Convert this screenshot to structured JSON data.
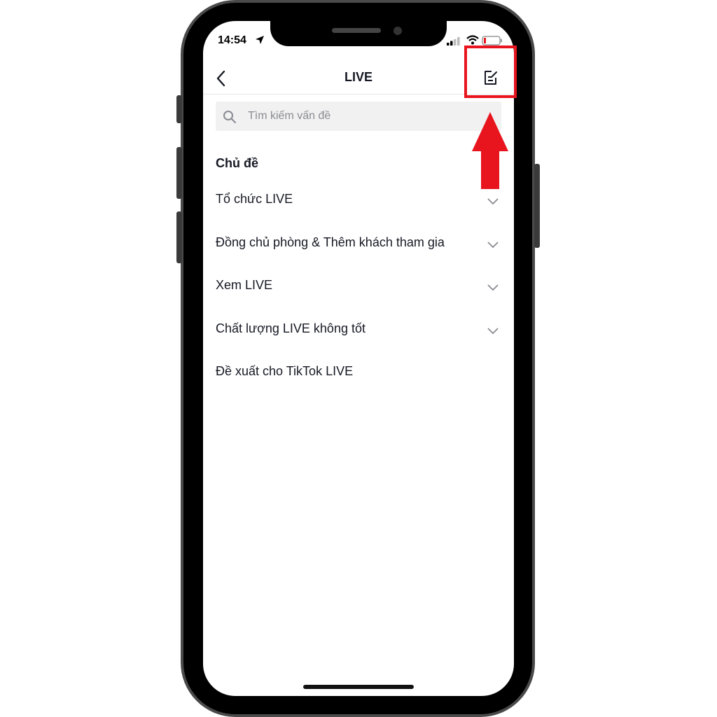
{
  "status_bar": {
    "time": "14:54"
  },
  "header": {
    "title": "LIVE"
  },
  "search": {
    "placeholder": "Tìm kiếm vấn đề"
  },
  "section": {
    "title": "Chủ đề"
  },
  "topics": [
    {
      "label": "Tổ chức LIVE",
      "expandable": true
    },
    {
      "label": "Đồng chủ phòng & Thêm khách tham gia",
      "expandable": true
    },
    {
      "label": "Xem LIVE",
      "expandable": true
    },
    {
      "label": "Chất lượng LIVE không tốt",
      "expandable": true
    },
    {
      "label": "Đề xuất cho TikTok LIVE",
      "expandable": false
    }
  ],
  "icons": {
    "back": "chevron-left-icon",
    "edit": "edit-note-icon",
    "search": "search-icon",
    "expand": "chevron-down-icon"
  },
  "colors": {
    "annotation": "#e8151e",
    "text": "#161823",
    "placeholder": "#8a8b91",
    "search_bg": "#f1f1f2"
  }
}
